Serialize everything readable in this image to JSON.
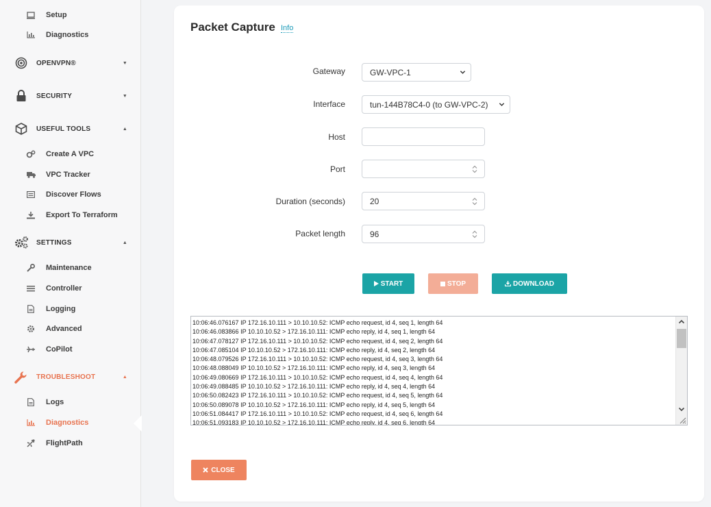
{
  "sidebar": {
    "top_items": [
      {
        "label": "Setup",
        "icon": "monitor-icon"
      },
      {
        "label": "Diagnostics",
        "icon": "bar-chart-icon"
      }
    ],
    "sections": {
      "openvpn": {
        "label": "OPENVPN®",
        "icon": "target-icon"
      },
      "security": {
        "label": "SECURITY",
        "icon": "lock-icon"
      },
      "useful_tools": {
        "label": "USEFUL TOOLS",
        "icon": "cube-icon"
      },
      "settings": {
        "label": "SETTINGS",
        "icon": "gears-icon"
      },
      "troubleshoot": {
        "label": "TROUBLESHOOT",
        "icon": "wrench-icon"
      }
    },
    "useful_tools_items": [
      {
        "label": "Create A VPC",
        "icon": "cogs-icon"
      },
      {
        "label": "VPC Tracker",
        "icon": "truck-icon"
      },
      {
        "label": "Discover Flows",
        "icon": "list-icon"
      },
      {
        "label": "Export To Terraform",
        "icon": "download-icon"
      }
    ],
    "settings_items": [
      {
        "label": "Maintenance",
        "icon": "wrench-icon"
      },
      {
        "label": "Controller",
        "icon": "bars-icon"
      },
      {
        "label": "Logging",
        "icon": "file-icon"
      },
      {
        "label": "Advanced",
        "icon": "gear-icon"
      },
      {
        "label": "CoPilot",
        "icon": "plane-icon"
      }
    ],
    "troubleshoot_items": [
      {
        "label": "Logs",
        "icon": "file-icon"
      },
      {
        "label": "Diagnostics",
        "icon": "bar-chart-icon"
      },
      {
        "label": "FlightPath",
        "icon": "plane-icon"
      }
    ]
  },
  "main": {
    "title": "Packet Capture",
    "info_link": "Info",
    "form": {
      "gateway": {
        "label": "Gateway",
        "value": "GW-VPC-1"
      },
      "interface": {
        "label": "Interface",
        "value": "tun-144B78C4-0 (to GW-VPC-2)"
      },
      "host": {
        "label": "Host",
        "value": ""
      },
      "port": {
        "label": "Port",
        "value": ""
      },
      "duration": {
        "label": "Duration (seconds)",
        "value": "20"
      },
      "packet_length": {
        "label": "Packet length",
        "value": "96"
      }
    },
    "buttons": {
      "start": "START",
      "stop": "STOP",
      "download": "DOWNLOAD",
      "close": "CLOSE"
    },
    "log_lines": [
      "10:06:46.076167 IP 172.16.10.111 > 10.10.10.52: ICMP echo request, id 4, seq 1, length 64",
      "10:06:46.083866 IP 10.10.10.52 > 172.16.10.111: ICMP echo reply, id 4, seq 1, length 64",
      "10:06:47.078127 IP 172.16.10.111 > 10.10.10.52: ICMP echo request, id 4, seq 2, length 64",
      "10:06:47.085104 IP 10.10.10.52 > 172.16.10.111: ICMP echo reply, id 4, seq 2, length 64",
      "10:06:48.079526 IP 172.16.10.111 > 10.10.10.52: ICMP echo request, id 4, seq 3, length 64",
      "10:06:48.088049 IP 10.10.10.52 > 172.16.10.111: ICMP echo reply, id 4, seq 3, length 64",
      "10:06:49.080669 IP 172.16.10.111 > 10.10.10.52: ICMP echo request, id 4, seq 4, length 64",
      "10:06:49.088485 IP 10.10.10.52 > 172.16.10.111: ICMP echo reply, id 4, seq 4, length 64",
      "10:06:50.082423 IP 172.16.10.111 > 10.10.10.52: ICMP echo request, id 4, seq 5, length 64",
      "10:06:50.089078 IP 10.10.10.52 > 172.16.10.111: ICMP echo reply, id 4, seq 5, length 64",
      "10:06:51.084417 IP 172.16.10.111 > 10.10.10.52: ICMP echo request, id 4, seq 6, length 64",
      "10:06:51.093183 IP 10.10.10.52 > 172.16.10.111: ICMP echo reply, id 4, seq 6, length 64"
    ]
  },
  "colors": {
    "accent_teal": "#1ba4a6",
    "accent_orange": "#e8734f",
    "stop_disabled": "#f3ad97",
    "close_button": "#ee845f",
    "link": "#1a9ab8"
  }
}
